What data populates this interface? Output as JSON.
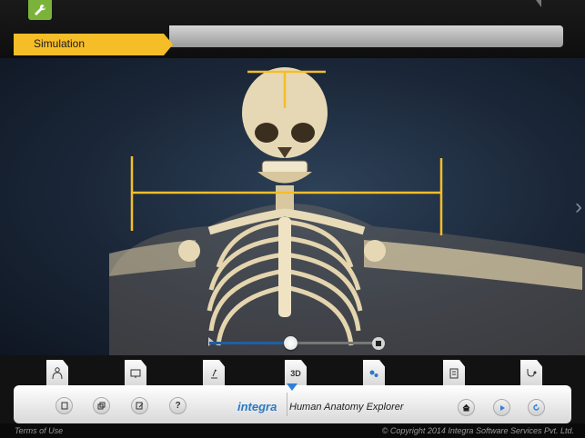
{
  "header": {
    "tool_icon": "wrench-icon",
    "simulation_tab": "Simulation"
  },
  "stage": {
    "next_arrow": "›",
    "playback_progress_fraction": 0.5
  },
  "module_tabs": [
    {
      "icon": "body-outline-icon",
      "text": ""
    },
    {
      "icon": "monitor-icon",
      "text": ""
    },
    {
      "icon": "microscope-icon",
      "text": ""
    },
    {
      "icon": "3d-icon",
      "text": "3D"
    },
    {
      "icon": "gears-icon",
      "text": ""
    },
    {
      "icon": "notes-icon",
      "text": ""
    },
    {
      "icon": "stethoscope-icon",
      "text": ""
    }
  ],
  "toolbar": {
    "help_label": "?",
    "brand_main": "integra",
    "app_title": "Human Anatomy Explorer",
    "left_buttons": [
      "document-icon",
      "layers-icon",
      "edit-icon",
      "help-icon"
    ],
    "right_buttons": [
      "home-icon",
      "play-icon",
      "refresh-icon"
    ]
  },
  "footer": {
    "terms": "Terms of Use",
    "copyright": "© Copyright 2014 Integra Software Services Pvt. Ltd."
  },
  "colors": {
    "accent_yellow": "#f5bd28",
    "brand_blue": "#2c7ac5",
    "tool_green": "#7bb33a"
  }
}
